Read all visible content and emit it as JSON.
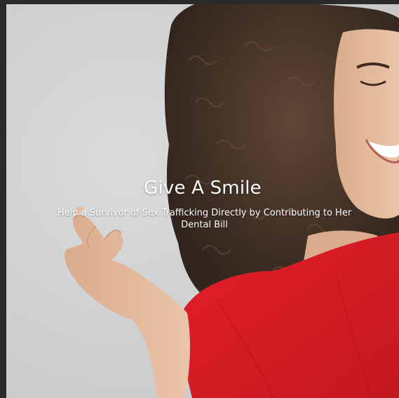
{
  "hero": {
    "title": "Give A Smile",
    "subtitle": "Help a Survivor of Sex Trafficking Directly by Contributing to Her Dental Bill",
    "image": "smiling-woman-red-shirt-curly-hair",
    "colors": {
      "shirt": "#d8121b",
      "hair": "#3a2a20",
      "skin": "#e2b698",
      "background": "#cfd0d1",
      "text": "#ffffff"
    }
  }
}
